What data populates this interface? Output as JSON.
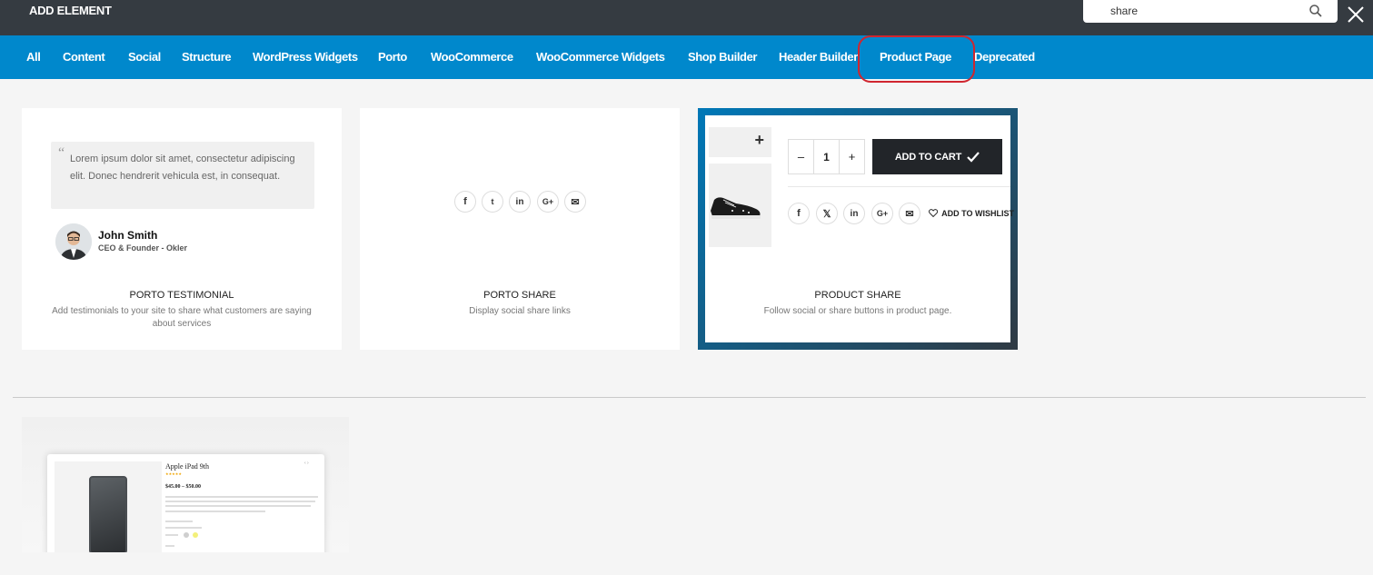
{
  "header": {
    "title": "ADD ELEMENT",
    "search_value": "share"
  },
  "tabs": [
    {
      "label": "All"
    },
    {
      "label": "Content"
    },
    {
      "label": "Social"
    },
    {
      "label": "Structure"
    },
    {
      "label": "WordPress Widgets"
    },
    {
      "label": "Porto"
    },
    {
      "label": "WooCommerce"
    },
    {
      "label": "WooCommerce Widgets"
    },
    {
      "label": "Shop Builder"
    },
    {
      "label": "Header Builder"
    },
    {
      "label": "Product Page"
    },
    {
      "label": "Deprecated"
    }
  ],
  "cards": [
    {
      "title": "PORTO TESTIMONIAL",
      "description": "Add testimonials to your site to share what customers are saying about services",
      "quote_mark": "“",
      "quote": "Lorem ipsum dolor sit amet, consectetur adipiscing elit. Donec hendrerit vehicula est, in consequat.",
      "author_name": "John Smith",
      "author_role": "CEO & Founder - Okler"
    },
    {
      "title": "PORTO SHARE",
      "description": "Display social share links",
      "icons": [
        "f",
        "t",
        "in",
        "G+",
        "✉"
      ]
    },
    {
      "title": "PRODUCT SHARE",
      "description": "Follow social or share buttons in product page.",
      "thumb_plus": "+",
      "qty_minus": "–",
      "qty_value": "1",
      "qty_plus": "+",
      "add_to_cart": "ADD TO CART",
      "icons": [
        "f",
        "𝕏",
        "in",
        "G+",
        "✉"
      ],
      "wishlist": "ADD TO WISHLIST"
    }
  ],
  "preview": {
    "title": "Apple iPad 9th",
    "price": "$45.00 – $50.00",
    "nav": "‹ ›"
  },
  "colors": {
    "tabbar": "#0088cc",
    "topbar": "#353b41",
    "highlight": "#d0262f"
  }
}
